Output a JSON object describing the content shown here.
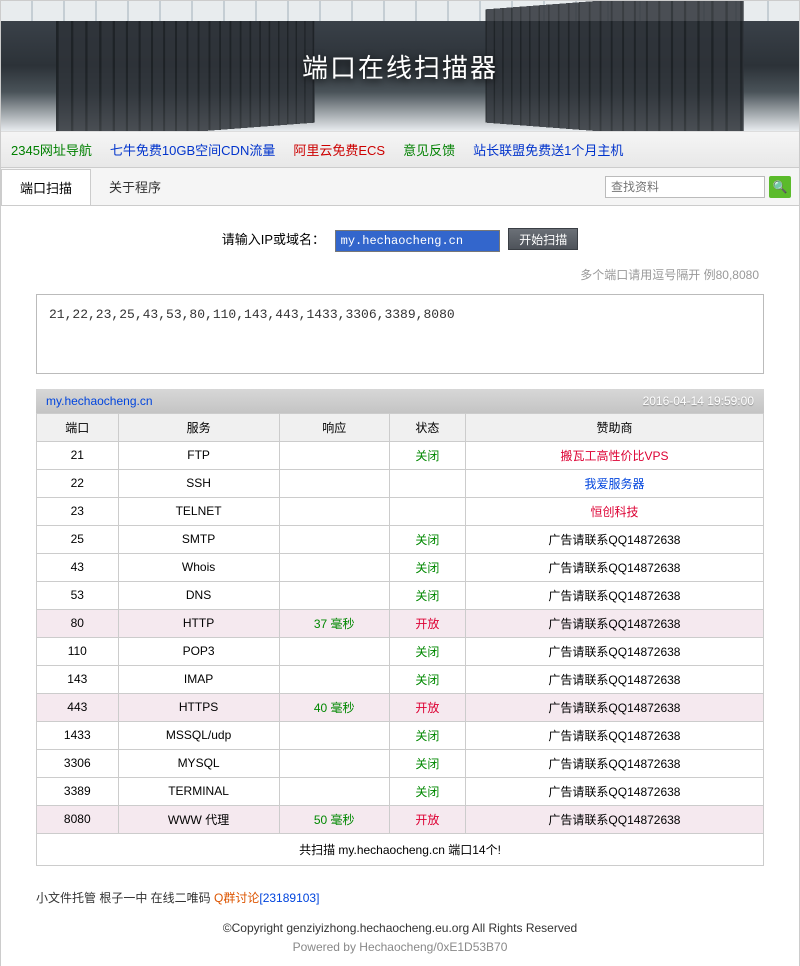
{
  "banner": {
    "title": "端口在线扫描器"
  },
  "nav": [
    {
      "label": "2345网址导航",
      "cls": "nav-green"
    },
    {
      "label": "七牛免费10GB空间CDN流量",
      "cls": "nav-blue"
    },
    {
      "label": "阿里云免费ECS",
      "cls": "nav-red"
    },
    {
      "label": "意见反馈",
      "cls": "nav-green"
    },
    {
      "label": "站长联盟免费送1个月主机",
      "cls": "nav-blue"
    }
  ],
  "tabs": {
    "active": "端口扫描",
    "inactive": "关于程序"
  },
  "search": {
    "placeholder": "查找资料"
  },
  "form": {
    "label": "请输入IP或域名：",
    "value": "my.hechaocheng.cn",
    "button": "开始扫描",
    "hint": "多个端口请用逗号隔开 例80,8080",
    "ports": "21,22,23,25,43,53,80,110,143,443,1433,3306,3389,8080"
  },
  "result": {
    "host": "my.hechaocheng.cn",
    "timestamp": "2016-04-14 19:59:00",
    "headers": [
      "端口",
      "服务",
      "响应",
      "状态",
      "赞助商"
    ],
    "sponsor_default": "广告请联系QQ14872638",
    "status_closed": "关闭",
    "status_open": "开放",
    "rows": [
      {
        "port": "21",
        "svc": "FTP",
        "resp": "",
        "open": false,
        "sponsor": "搬瓦工高性价比VPS",
        "sponsor_cls": "sp-red"
      },
      {
        "port": "22",
        "svc": "SSH",
        "resp": "",
        "open": false,
        "no_status": true,
        "sponsor": "我爱服务器",
        "sponsor_cls": "sp-blue"
      },
      {
        "port": "23",
        "svc": "TELNET",
        "resp": "",
        "open": false,
        "no_status": true,
        "sponsor": "恒创科技",
        "sponsor_cls": "sp-red"
      },
      {
        "port": "25",
        "svc": "SMTP",
        "resp": "",
        "open": false
      },
      {
        "port": "43",
        "svc": "Whois",
        "resp": "",
        "open": false
      },
      {
        "port": "53",
        "svc": "DNS",
        "resp": "",
        "open": false
      },
      {
        "port": "80",
        "svc": "HTTP",
        "resp": "37 毫秒",
        "open": true
      },
      {
        "port": "110",
        "svc": "POP3",
        "resp": "",
        "open": false
      },
      {
        "port": "143",
        "svc": "IMAP",
        "resp": "",
        "open": false
      },
      {
        "port": "443",
        "svc": "HTTPS",
        "resp": "40 毫秒",
        "open": true
      },
      {
        "port": "1433",
        "svc": "MSSQL/udp",
        "resp": "",
        "open": false
      },
      {
        "port": "3306",
        "svc": "MYSQL",
        "resp": "",
        "open": false
      },
      {
        "port": "3389",
        "svc": "TERMINAL",
        "resp": "",
        "open": false
      },
      {
        "port": "8080",
        "svc": "WWW 代理",
        "resp": "50 毫秒",
        "open": true
      }
    ],
    "summary": "共扫描 my.hechaocheng.cn 端口14个!"
  },
  "footer": {
    "links": "小文件托管 根子一中 在线二唯码 ",
    "qlabel": "Q群讨论",
    "qnum": "[23189103]",
    "copyright": "©Copyright genziyizhong.hechaocheng.eu.org All Rights Reserved",
    "powered": "Powered by Hechaocheng/0xE1D53B70"
  }
}
